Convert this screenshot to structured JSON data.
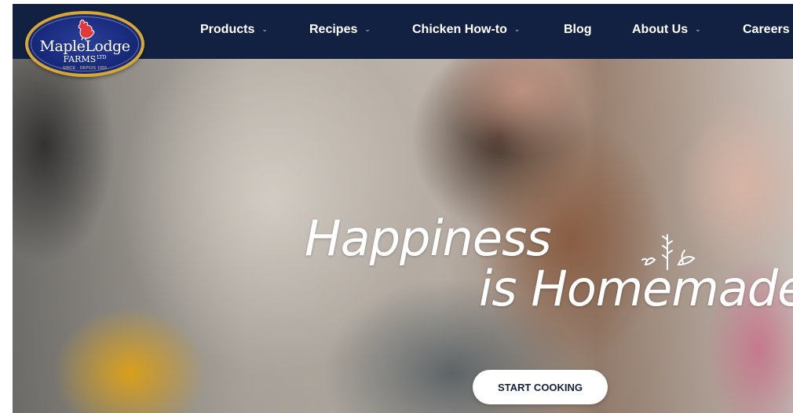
{
  "brand": {
    "name": "MapleLodge",
    "sub": "FARMS",
    "suffix": "LTD",
    "tagline": "SINCE · DEPUIS 1955",
    "logo_icon": "rooster-icon",
    "colors": {
      "navy": "#122141",
      "gold": "#d7a930",
      "logo_blue": "#1a2c86"
    }
  },
  "nav": {
    "items": [
      {
        "label": "Products",
        "has_dropdown": true
      },
      {
        "label": "Recipes",
        "has_dropdown": true
      },
      {
        "label": "Chicken How-to",
        "has_dropdown": true
      },
      {
        "label": "Blog",
        "has_dropdown": false
      },
      {
        "label": "About Us",
        "has_dropdown": true
      },
      {
        "label": "Careers",
        "has_dropdown": false
      }
    ],
    "dropdown_icon": "chevron-down-icon"
  },
  "hero": {
    "headline_line1": "Happiness",
    "headline_line2": "is Homemade",
    "decoration_icon": "herb-sprig-icon",
    "cta_label": "START COOKING"
  }
}
